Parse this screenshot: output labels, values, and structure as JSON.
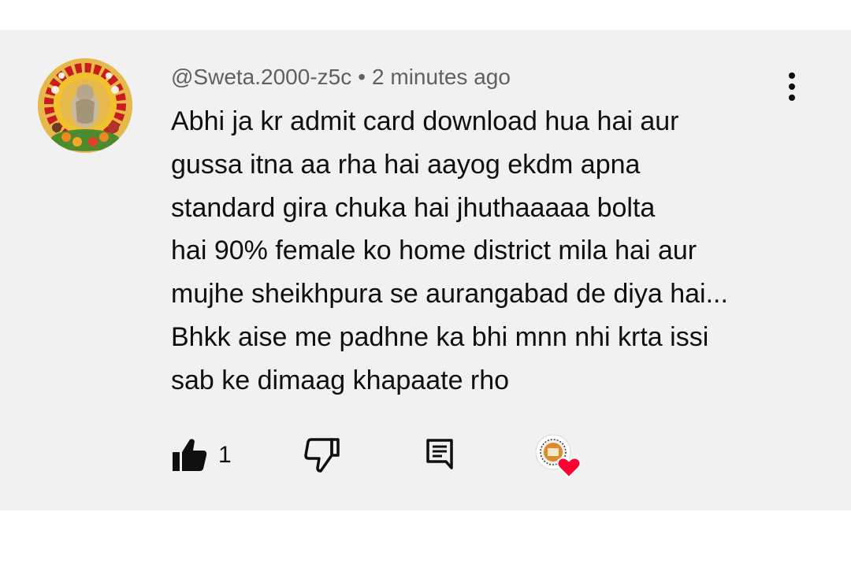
{
  "comment": {
    "author": "@Sweta.2000-z5c",
    "separator": "•",
    "time": "2 minutes ago",
    "lines": [
      "Abhi ja kr admit card download hua hai aur",
      "gussa itna aa rha hai aayog ekdm apna",
      "standard gira chuka hai jhuthaaaaa bolta",
      "hai 90% female ko home district mila hai aur",
      "mujhe sheikhpura se aurangabad de diya hai...",
      "Bhkk aise me padhne ka bhi mnn nhi krta issi",
      "sab ke dimaag khapaate rho"
    ]
  },
  "actions": {
    "like_count": "1",
    "like_icon": "thumbs-up-filled-icon",
    "dislike_icon": "thumbs-down-outline-icon",
    "reply_icon": "comment-reply-icon",
    "more_icon": "vertical-ellipsis-icon",
    "heart_icon": "creator-heart-icon"
  },
  "colors": {
    "card_background": "#f1f1f1",
    "text_primary": "#0f0f0f",
    "text_secondary": "#606060",
    "heart": "#ff0033"
  }
}
